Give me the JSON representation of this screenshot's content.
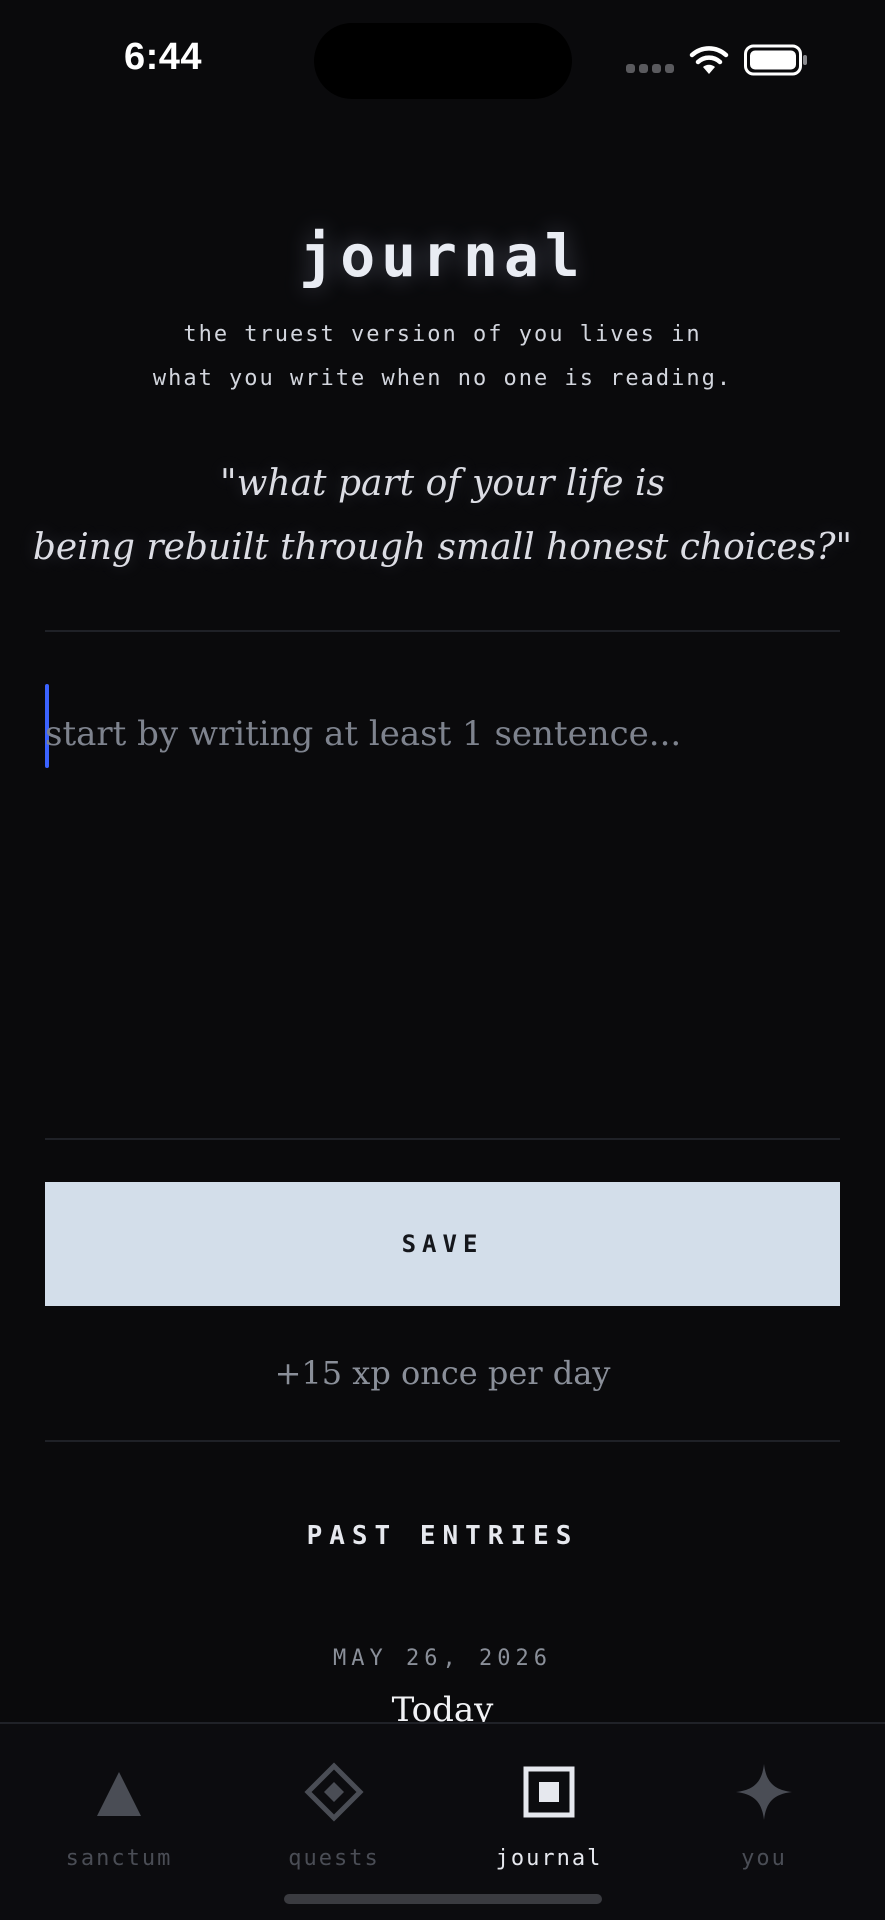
{
  "status_bar": {
    "time": "6:44"
  },
  "header": {
    "title": "journal",
    "subtitle_line1": "the truest version of you lives in",
    "subtitle_line2": "what you write when no one is reading.",
    "prompt_line1": "\"what part of your life is",
    "prompt_line2": "being rebuilt through small honest choices?\""
  },
  "editor": {
    "placeholder": "start by writing at least 1 sentence..."
  },
  "save": {
    "label": "SAVE",
    "xp_note": "+15 xp once per day"
  },
  "past_entries": {
    "title": "PAST ENTRIES",
    "entries": [
      {
        "date": "MAY 26, 2026",
        "label": "Today"
      }
    ]
  },
  "tabs": [
    {
      "label": "sanctum",
      "icon": "triangle-icon",
      "active": false
    },
    {
      "label": "quests",
      "icon": "diamond-icon",
      "active": false
    },
    {
      "label": "journal",
      "icon": "square-icon",
      "active": true
    },
    {
      "label": "you",
      "icon": "sparkle-icon",
      "active": false
    }
  ],
  "colors": {
    "background": "#0a0a0c",
    "accent_cursor": "#3b63ff",
    "save_button": "#d3deea",
    "muted_text": "#8a8f99",
    "inactive_tab": "#4a4d55"
  }
}
